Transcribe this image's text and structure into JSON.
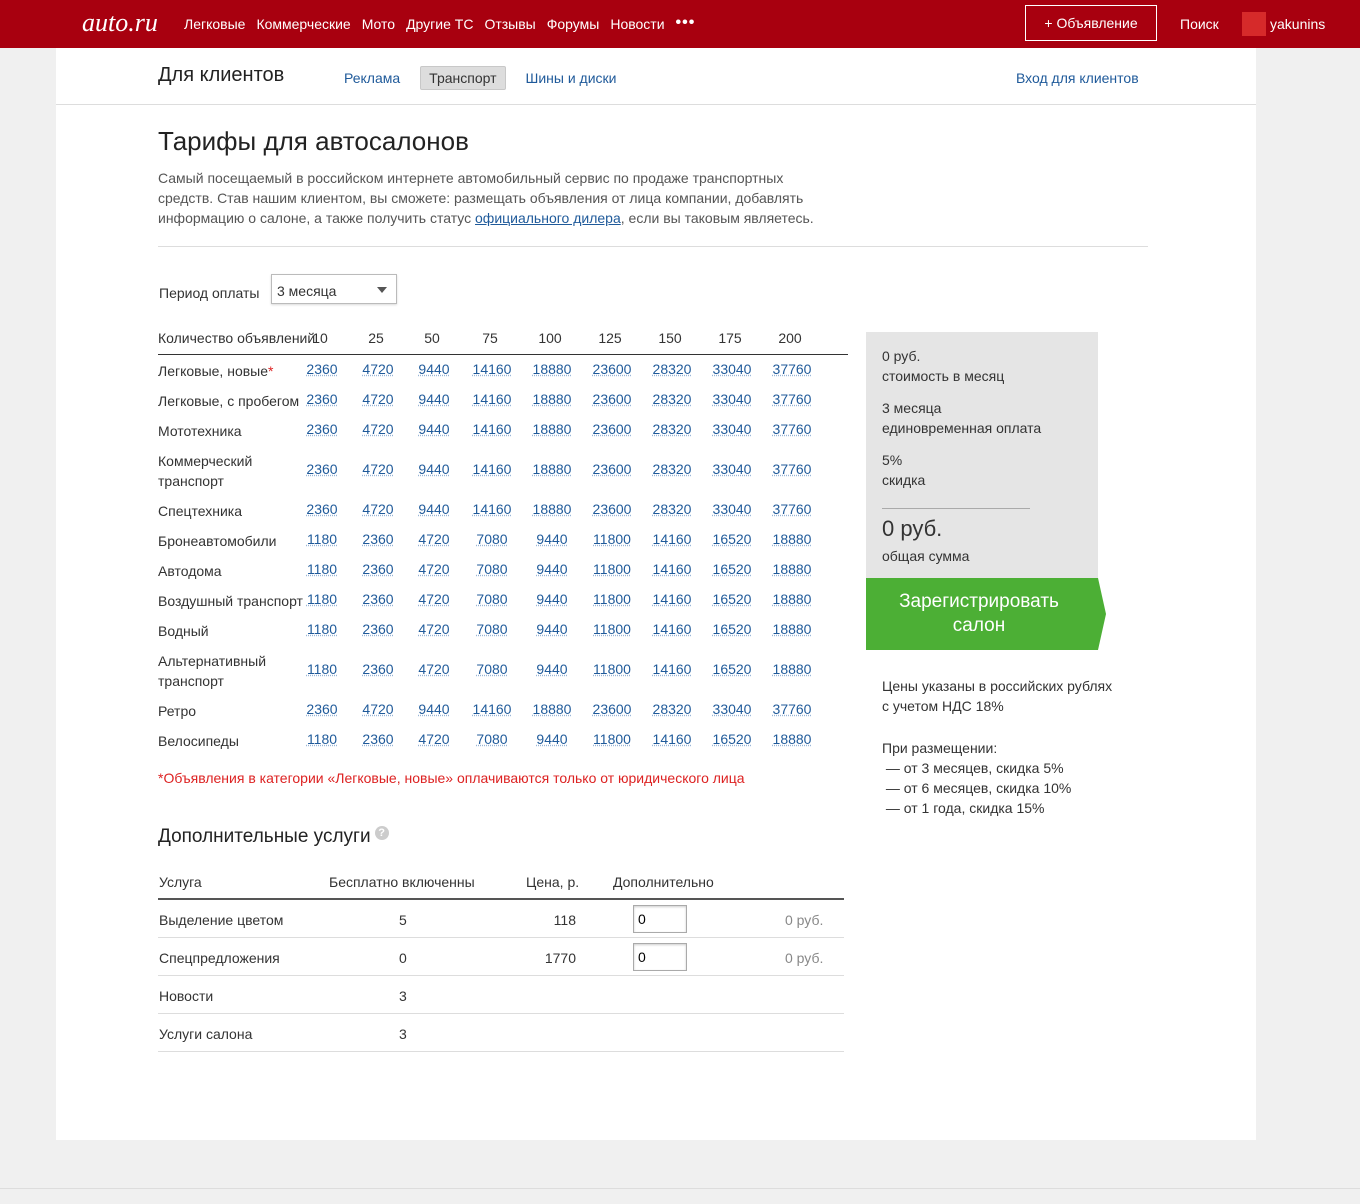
{
  "topbar": {
    "logo": "auto.ru",
    "nav": [
      "Легковые",
      "Коммерческие",
      "Мото",
      "Другие ТС",
      "Отзывы",
      "Форумы",
      "Новости"
    ],
    "more": "•••",
    "add_ad": "+ Объявление",
    "search": "Поиск",
    "username": "yakunins"
  },
  "subheader": {
    "title": "Для клиентов",
    "tabs": [
      "Реклама",
      "Транспорт",
      "Шины и диски"
    ],
    "active_tab": "Транспорт",
    "login": "Вход для клиентов"
  },
  "page": {
    "title": "Тарифы для автосалонов",
    "intro_line1": "Самый посещаемый в российском интернете автомобильный сервис по продаже транспортных",
    "intro_line2": "средств. Став нашим клиентом, вы сможете: размещать объявления от лица компании, добавлять",
    "intro_line3_start": "информацию о салоне, а также получить статус ",
    "intro_link": "официального дилера",
    "intro_line3_end": ", если вы таковым являетесь."
  },
  "period": {
    "label": "Период оплаты",
    "selected": "3 месяца"
  },
  "tariff": {
    "header_label": "Количество объявлений",
    "counts": [
      "10",
      "25",
      "50",
      "75",
      "100",
      "125",
      "150",
      "175",
      "200"
    ],
    "rows": [
      {
        "label": "Легковые, новые",
        "star": "*",
        "values": [
          "2360",
          "4720",
          "9440",
          "14160",
          "18880",
          "23600",
          "28320",
          "33040",
          "37760"
        ]
      },
      {
        "label": "Легковые, с пробегом",
        "values": [
          "2360",
          "4720",
          "9440",
          "14160",
          "18880",
          "23600",
          "28320",
          "33040",
          "37760"
        ]
      },
      {
        "label": "Мототехника",
        "values": [
          "2360",
          "4720",
          "9440",
          "14160",
          "18880",
          "23600",
          "28320",
          "33040",
          "37760"
        ]
      },
      {
        "label1": "Коммерческий",
        "label2": "транспорт",
        "values": [
          "2360",
          "4720",
          "9440",
          "14160",
          "18880",
          "23600",
          "28320",
          "33040",
          "37760"
        ]
      },
      {
        "label": "Спецтехника",
        "values": [
          "2360",
          "4720",
          "9440",
          "14160",
          "18880",
          "23600",
          "28320",
          "33040",
          "37760"
        ]
      },
      {
        "label": "Бронеавтомобили",
        "values": [
          "1180",
          "2360",
          "4720",
          "7080",
          "9440",
          "11800",
          "14160",
          "16520",
          "18880"
        ]
      },
      {
        "label": "Автодома",
        "values": [
          "1180",
          "2360",
          "4720",
          "7080",
          "9440",
          "11800",
          "14160",
          "16520",
          "18880"
        ]
      },
      {
        "label": "Воздушный транспорт",
        "values": [
          "1180",
          "2360",
          "4720",
          "7080",
          "9440",
          "11800",
          "14160",
          "16520",
          "18880"
        ]
      },
      {
        "label": "Водный",
        "values": [
          "1180",
          "2360",
          "4720",
          "7080",
          "9440",
          "11800",
          "14160",
          "16520",
          "18880"
        ]
      },
      {
        "label1": "Альтернативный",
        "label2": "транспорт",
        "values": [
          "1180",
          "2360",
          "4720",
          "7080",
          "9440",
          "11800",
          "14160",
          "16520",
          "18880"
        ]
      },
      {
        "label": "Ретро",
        "values": [
          "2360",
          "4720",
          "9440",
          "14160",
          "18880",
          "23600",
          "28320",
          "33040",
          "37760"
        ]
      },
      {
        "label": "Велосипеды",
        "values": [
          "1180",
          "2360",
          "4720",
          "7080",
          "9440",
          "11800",
          "14160",
          "16520",
          "18880"
        ]
      }
    ],
    "footnote": "*Объявления в категории «Легковые, новые» оплачиваются только от юридического лица"
  },
  "summary": {
    "monthly_value": "0 руб.",
    "monthly_label": "стоимость в месяц",
    "period_value": "3 месяца",
    "period_label": "единовременная оплата",
    "discount_value": "5%",
    "discount_label": "скидка",
    "total_value": "0 руб.",
    "total_label": "общая сумма",
    "register_line1": "Зарегистрировать",
    "register_line2": "салон",
    "register_color": "#4caf35"
  },
  "notes": {
    "line1": "Цены указаны в российских рублях",
    "line2": "с учетом НДС 18%",
    "line3": "При размещении:",
    "line4": " — от 3 месяцев, скидка 5%",
    "line5": " — от 6 месяцев, скидка 10%",
    "line6": " — от 1 года, скидка 15%"
  },
  "services": {
    "title": "Дополнительные услуги",
    "help": "?",
    "headers": {
      "service": "Услуга",
      "free": "Бесплатно включенны",
      "price": "Цена, р.",
      "extra": "Дополнительно"
    },
    "rows": [
      {
        "name": "Выделение цветом",
        "free": "5",
        "price": "118",
        "extra": "0",
        "total": "0 руб."
      },
      {
        "name": "Спецпредложения",
        "free": "0",
        "price": "1770",
        "extra": "0",
        "total": "0 руб."
      },
      {
        "name": "Новости",
        "free": "3"
      },
      {
        "name": "Услуги салона",
        "free": "3"
      }
    ]
  }
}
